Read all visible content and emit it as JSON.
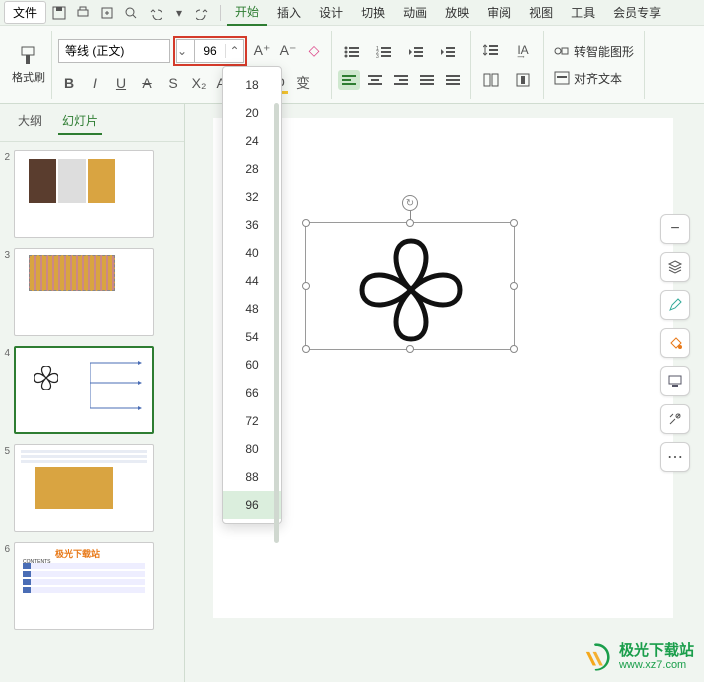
{
  "menubar": {
    "file": "文件",
    "tabs": [
      "开始",
      "插入",
      "设计",
      "切换",
      "动画",
      "放映",
      "审阅",
      "视图",
      "工具",
      "会员专享"
    ],
    "active_tab": 0
  },
  "ribbon": {
    "format_painter": "格式刷",
    "font_name": "等线 (正文)",
    "font_size": "96",
    "smart_graphic": "转智能图形",
    "align_text": "对齐文本"
  },
  "sidebar": {
    "tabs": {
      "outline": "大纲",
      "slides": "幻灯片"
    },
    "active": "slides"
  },
  "thumbs": [
    {
      "n": "2"
    },
    {
      "n": "3"
    },
    {
      "n": "4"
    },
    {
      "n": "5"
    },
    {
      "n": "6"
    }
  ],
  "thumb6_title": "极光下载站",
  "thumb6_sub": "CONTENTS",
  "size_options": [
    "18",
    "20",
    "24",
    "28",
    "32",
    "36",
    "40",
    "44",
    "48",
    "54",
    "60",
    "66",
    "72",
    "80",
    "88",
    "96"
  ],
  "size_selected": "96",
  "watermark": {
    "cn": "极光下载站",
    "url": "www.xz7.com"
  },
  "icons": {
    "save": "save",
    "print": "print",
    "undo": "undo",
    "redo": "redo",
    "collapse": "minus",
    "layers": "layers",
    "pen": "pen",
    "bucket": "bucket",
    "screen": "screen",
    "tools": "tools",
    "more": "more"
  }
}
